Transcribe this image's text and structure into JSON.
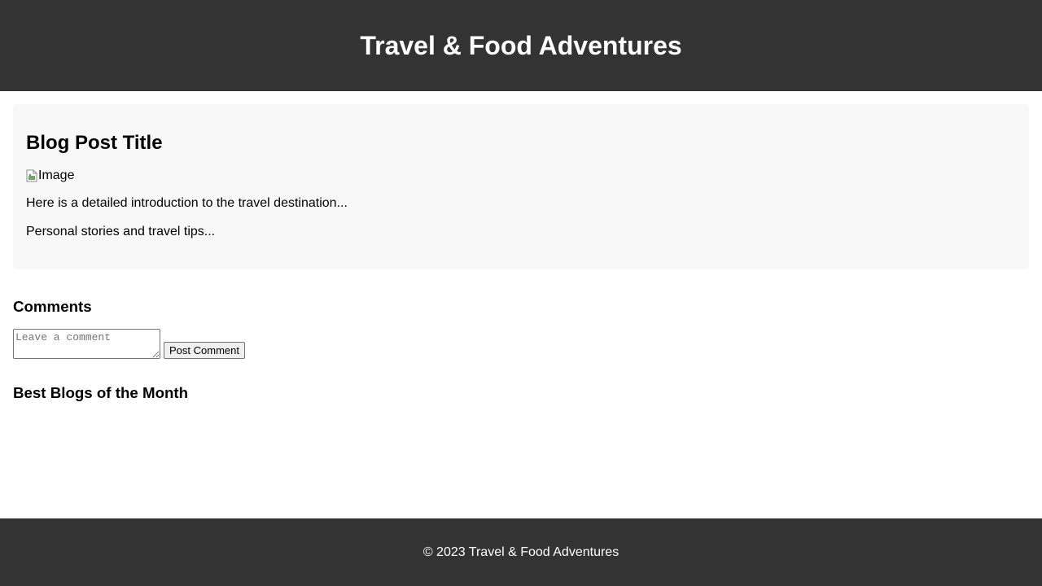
{
  "header": {
    "title": "Travel & Food Adventures"
  },
  "post": {
    "title": "Blog Post Title",
    "image_alt": "Image",
    "introduction": "Here is a detailed introduction to the travel destination...",
    "stories": "Personal stories and travel tips..."
  },
  "comments": {
    "heading": "Comments",
    "placeholder": "Leave a comment",
    "value": "",
    "submit_label": "Post Comment"
  },
  "best_blogs": {
    "heading": "Best Blogs of the Month"
  },
  "footer": {
    "text": "© 2023 Travel & Food Adventures"
  },
  "colors": {
    "header_bg": "#333333",
    "card_bg": "#f8f8f8",
    "footer_bg": "#333333"
  }
}
